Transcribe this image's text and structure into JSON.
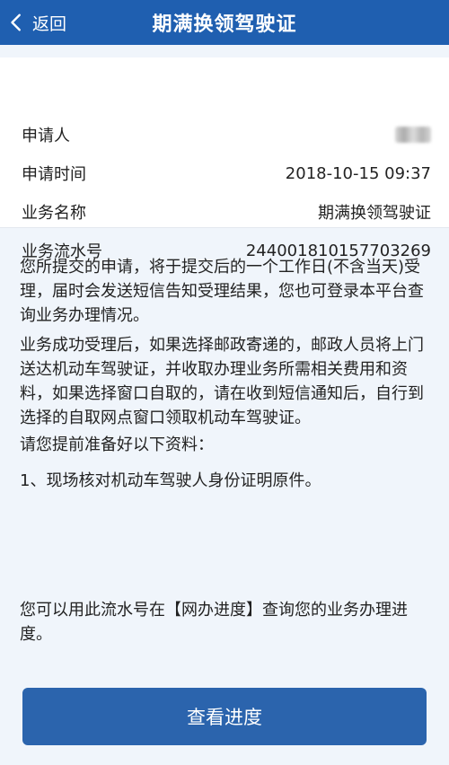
{
  "header": {
    "back_label": "返回",
    "title": "期满换领驾驶证"
  },
  "info": {
    "rows": [
      {
        "label": "申请人",
        "value": ""
      },
      {
        "label": "申请时间",
        "value": "2018-10-15 09:37"
      },
      {
        "label": "业务名称",
        "value": "期满换领驾驶证"
      },
      {
        "label": "业务流水号",
        "value": "244001810157703269"
      }
    ]
  },
  "content": {
    "p1": "您所提交的申请，将于提交后的一个工作日(不含当天)受理，届时会发送短信告知受理结果，您也可登录本平台查询业务办理情况。",
    "p2": "业务成功受理后，如果选择邮政寄递的，邮政人员将上门送达机动车驾驶证，并收取办理业务所需相关费用和资料，如果选择窗口自取的，请在收到短信通知后，自行到选择的自取网点窗口领取机动车驾驶证。",
    "p3": "请您提前准备好以下资料：",
    "p4": "1、现场核对机动车驾驶人身份证明原件。",
    "p5": "您可以用此流水号在【网办进度】查询您的业务办理进度。"
  },
  "button": {
    "label": "查看进度"
  },
  "colors": {
    "header_bg": "#1f5fb0",
    "button_bg": "#2b64ad",
    "page_bg": "#f0f5fb"
  }
}
